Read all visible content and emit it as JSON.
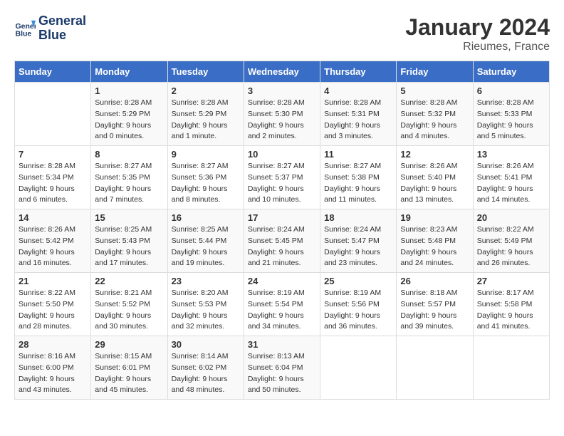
{
  "header": {
    "logo_line1": "General",
    "logo_line2": "Blue",
    "month": "January 2024",
    "location": "Rieumes, France"
  },
  "weekdays": [
    "Sunday",
    "Monday",
    "Tuesday",
    "Wednesday",
    "Thursday",
    "Friday",
    "Saturday"
  ],
  "weeks": [
    [
      {
        "day": "",
        "info": ""
      },
      {
        "day": "1",
        "info": "Sunrise: 8:28 AM\nSunset: 5:29 PM\nDaylight: 9 hours\nand 0 minutes."
      },
      {
        "day": "2",
        "info": "Sunrise: 8:28 AM\nSunset: 5:29 PM\nDaylight: 9 hours\nand 1 minute."
      },
      {
        "day": "3",
        "info": "Sunrise: 8:28 AM\nSunset: 5:30 PM\nDaylight: 9 hours\nand 2 minutes."
      },
      {
        "day": "4",
        "info": "Sunrise: 8:28 AM\nSunset: 5:31 PM\nDaylight: 9 hours\nand 3 minutes."
      },
      {
        "day": "5",
        "info": "Sunrise: 8:28 AM\nSunset: 5:32 PM\nDaylight: 9 hours\nand 4 minutes."
      },
      {
        "day": "6",
        "info": "Sunrise: 8:28 AM\nSunset: 5:33 PM\nDaylight: 9 hours\nand 5 minutes."
      }
    ],
    [
      {
        "day": "7",
        "info": "Sunrise: 8:28 AM\nSunset: 5:34 PM\nDaylight: 9 hours\nand 6 minutes."
      },
      {
        "day": "8",
        "info": "Sunrise: 8:27 AM\nSunset: 5:35 PM\nDaylight: 9 hours\nand 7 minutes."
      },
      {
        "day": "9",
        "info": "Sunrise: 8:27 AM\nSunset: 5:36 PM\nDaylight: 9 hours\nand 8 minutes."
      },
      {
        "day": "10",
        "info": "Sunrise: 8:27 AM\nSunset: 5:37 PM\nDaylight: 9 hours\nand 10 minutes."
      },
      {
        "day": "11",
        "info": "Sunrise: 8:27 AM\nSunset: 5:38 PM\nDaylight: 9 hours\nand 11 minutes."
      },
      {
        "day": "12",
        "info": "Sunrise: 8:26 AM\nSunset: 5:40 PM\nDaylight: 9 hours\nand 13 minutes."
      },
      {
        "day": "13",
        "info": "Sunrise: 8:26 AM\nSunset: 5:41 PM\nDaylight: 9 hours\nand 14 minutes."
      }
    ],
    [
      {
        "day": "14",
        "info": "Sunrise: 8:26 AM\nSunset: 5:42 PM\nDaylight: 9 hours\nand 16 minutes."
      },
      {
        "day": "15",
        "info": "Sunrise: 8:25 AM\nSunset: 5:43 PM\nDaylight: 9 hours\nand 17 minutes."
      },
      {
        "day": "16",
        "info": "Sunrise: 8:25 AM\nSunset: 5:44 PM\nDaylight: 9 hours\nand 19 minutes."
      },
      {
        "day": "17",
        "info": "Sunrise: 8:24 AM\nSunset: 5:45 PM\nDaylight: 9 hours\nand 21 minutes."
      },
      {
        "day": "18",
        "info": "Sunrise: 8:24 AM\nSunset: 5:47 PM\nDaylight: 9 hours\nand 23 minutes."
      },
      {
        "day": "19",
        "info": "Sunrise: 8:23 AM\nSunset: 5:48 PM\nDaylight: 9 hours\nand 24 minutes."
      },
      {
        "day": "20",
        "info": "Sunrise: 8:22 AM\nSunset: 5:49 PM\nDaylight: 9 hours\nand 26 minutes."
      }
    ],
    [
      {
        "day": "21",
        "info": "Sunrise: 8:22 AM\nSunset: 5:50 PM\nDaylight: 9 hours\nand 28 minutes."
      },
      {
        "day": "22",
        "info": "Sunrise: 8:21 AM\nSunset: 5:52 PM\nDaylight: 9 hours\nand 30 minutes."
      },
      {
        "day": "23",
        "info": "Sunrise: 8:20 AM\nSunset: 5:53 PM\nDaylight: 9 hours\nand 32 minutes."
      },
      {
        "day": "24",
        "info": "Sunrise: 8:19 AM\nSunset: 5:54 PM\nDaylight: 9 hours\nand 34 minutes."
      },
      {
        "day": "25",
        "info": "Sunrise: 8:19 AM\nSunset: 5:56 PM\nDaylight: 9 hours\nand 36 minutes."
      },
      {
        "day": "26",
        "info": "Sunrise: 8:18 AM\nSunset: 5:57 PM\nDaylight: 9 hours\nand 39 minutes."
      },
      {
        "day": "27",
        "info": "Sunrise: 8:17 AM\nSunset: 5:58 PM\nDaylight: 9 hours\nand 41 minutes."
      }
    ],
    [
      {
        "day": "28",
        "info": "Sunrise: 8:16 AM\nSunset: 6:00 PM\nDaylight: 9 hours\nand 43 minutes."
      },
      {
        "day": "29",
        "info": "Sunrise: 8:15 AM\nSunset: 6:01 PM\nDaylight: 9 hours\nand 45 minutes."
      },
      {
        "day": "30",
        "info": "Sunrise: 8:14 AM\nSunset: 6:02 PM\nDaylight: 9 hours\nand 48 minutes."
      },
      {
        "day": "31",
        "info": "Sunrise: 8:13 AM\nSunset: 6:04 PM\nDaylight: 9 hours\nand 50 minutes."
      },
      {
        "day": "",
        "info": ""
      },
      {
        "day": "",
        "info": ""
      },
      {
        "day": "",
        "info": ""
      }
    ]
  ]
}
